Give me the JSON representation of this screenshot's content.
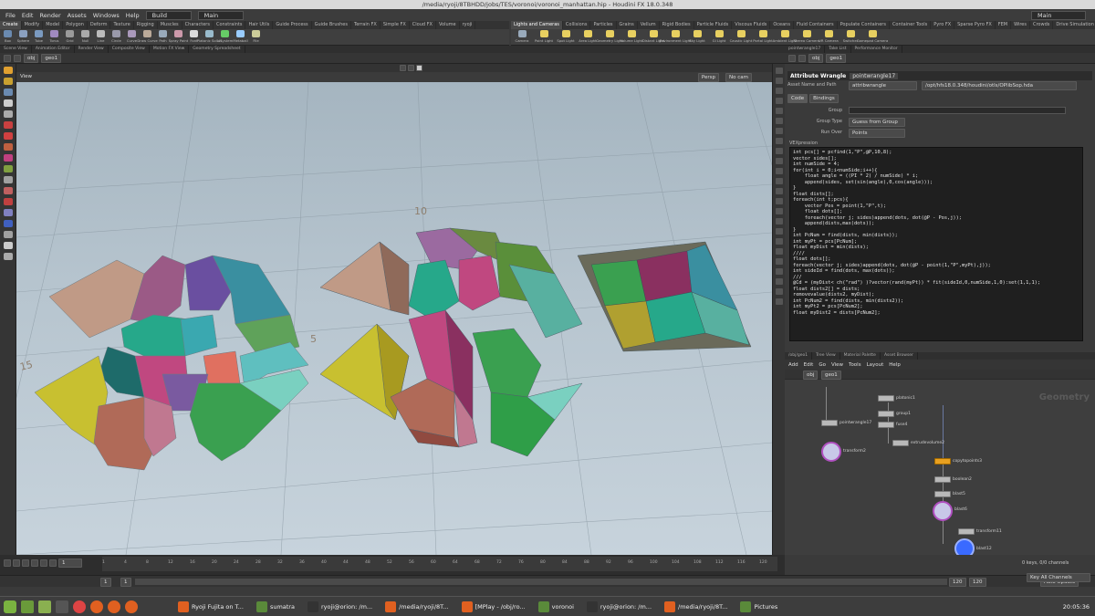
{
  "window_title": "/media/ryoji/8TBHDD/jobs/TES/voronoi/voronoi_manhattan.hip - Houdini FX 18.0.348",
  "menu": [
    "File",
    "Edit",
    "Render",
    "Assets",
    "Windows",
    "Help"
  ],
  "desktop": "Build",
  "session": "Main",
  "main_right": "Main",
  "shelf_tabs_left": [
    "Create",
    "Modify",
    "Model",
    "Polygon",
    "Deform",
    "Texture",
    "Rigging",
    "Muscles",
    "Characters",
    "Constraints",
    "Hair Utils",
    "Guide Process",
    "Guide Brushes",
    "Terrain FX",
    "Simple FX",
    "Cloud FX",
    "Volume",
    "ryoji"
  ],
  "shelf_tabs_right": [
    "Lights and Cameras",
    "Collisions",
    "Particles",
    "Grains",
    "Vellum",
    "Rigid Bodies",
    "Particle Fluids",
    "Viscous Fluids",
    "Oceans",
    "Fluid Containers",
    "Populate Containers",
    "Container Tools",
    "Pyro FX",
    "Sparse Pyro FX",
    "FEM",
    "Wires",
    "Crowds",
    "Drive Simulation"
  ],
  "tools_left": [
    "Box",
    "Sphere",
    "Tube",
    "Torus",
    "Grid",
    "Null",
    "Line",
    "Circle",
    "Curve",
    "Draw Curve",
    "Path",
    "Spray Paint",
    "Font",
    "Platonic Solids",
    "L-System",
    "Metaball",
    "File"
  ],
  "tools_right": [
    "Camera",
    "Point Light",
    "Spot Light",
    "Area Light",
    "Geometry Light",
    "Volume Light",
    "Distant Light",
    "Environment Light",
    "Sky Light",
    "GI Light",
    "Caustic Light",
    "Portal Light",
    "Ambient Light",
    "Stereo Camera",
    "VR Camera",
    "Switcher",
    "Gamepad Camera"
  ],
  "left_pane_tabs": [
    "Scene View",
    "Animation Editor",
    "Render View",
    "Composite View",
    "Motion FX View",
    "Geometry Spreadsheet"
  ],
  "right_top_tabs": [
    "pointwrangle17",
    "Take List",
    "Performance Monitor"
  ],
  "path": {
    "obj": "obj",
    "geo": "geo1"
  },
  "viewport": {
    "label": "View",
    "persp": "Persp",
    "cam": "No cam",
    "grid_labels": [
      "15",
      "5",
      "5",
      "10"
    ]
  },
  "params": {
    "node_type": "Attribute Wrangle",
    "node_name": "pointwrangle17",
    "asset_label": "Asset Name and Path",
    "asset_name": "attribwrangle",
    "asset_path": "/opt/hfs18.0.348/houdini/otls/OPlibSop.hda",
    "tabs": [
      "Code",
      "Bindings"
    ],
    "group_label": "Group",
    "group_type_label": "Group Type",
    "group_type_value": "Guess from Group",
    "run_over_label": "Run Over",
    "run_over_value": "Points",
    "vex_label": "VEXpression"
  },
  "code_lines": [
    "int pcs[] = pcfind(1,\"P\",@P,10,8);",
    "",
    "vector sides[];",
    "int numSide = 4;",
    "for(int i = 0;i<numSide;i++){",
    "    float angle = ((PI * 2) / numSide) * i;",
    "    append(sides, set(sin(angle),0,cos(angle)));",
    "}",
    "float dists[];",
    "foreach(int t;pcs){",
    "    vector Pos = point(1,\"P\",t);",
    "    float dots[];",
    "    foreach(vector j; sides)append(dots, dot(@P - Pos,j));",
    "    append(dists,max(dots));",
    "}",
    "int PcNum = find(dists, min(dists));",
    "int myPt = pcs[PcNum];",
    "float myDist = min(dists);",
    "////",
    "float dots[];",
    "foreach(vector j; sides)append(dots, dot(@P - point(1,\"P\",myPt),j));",
    "int sideId = find(dots, max(dots));",
    "///",
    "@Cd = (myDist< ch(\"rad\") )?vector(rand(myPt)) * fit(sideId,0,numSide,1,0):set(1,1,1);",
    "",
    "float dists2[] = dists;",
    "removevalue(dists2, myDist);",
    "int PcNum2 = find(dists, min(dists2));",
    "int myPt2 = pcs[PcNum2];",
    "float myDist2 = dists[PcNum2];"
  ],
  "net_tabs": [
    "/obj/geo1",
    "Tree View",
    "Material Palette",
    "Asset Browser"
  ],
  "net_menu": [
    "Add",
    "Edit",
    "Go",
    "View",
    "Tools",
    "Layout",
    "Help"
  ],
  "net_watermark": "Geometry",
  "nodes": [
    {
      "name": "platonic1"
    },
    {
      "name": "group1"
    },
    {
      "name": "fuse4"
    },
    {
      "name": "pointwrangle17"
    },
    {
      "name": "transform2"
    },
    {
      "name": "extrudevolume2"
    },
    {
      "name": "copytopoints3"
    },
    {
      "name": "boolean2"
    },
    {
      "name": "blast5"
    },
    {
      "name": "blast6"
    },
    {
      "name": "transform11"
    },
    {
      "name": "blast12"
    }
  ],
  "timeline": {
    "frame": "1",
    "start": "1",
    "start2": "1",
    "end": "120",
    "end2": "120",
    "ticks": [
      "1",
      "4",
      "8",
      "12",
      "16",
      "20",
      "24",
      "28",
      "32",
      "36",
      "40",
      "44",
      "48",
      "52",
      "56",
      "60",
      "64",
      "68",
      "72",
      "76",
      "80",
      "84",
      "88",
      "92",
      "96",
      "100",
      "104",
      "108",
      "112",
      "116",
      "120"
    ]
  },
  "status": {
    "keys": "0 keys, 0/0 channels",
    "channels": "Key All Channels",
    "update": "Auto Update"
  },
  "taskbar": [
    {
      "label": "Ryoji Fujita on T..."
    },
    {
      "label": "sumatra"
    },
    {
      "label": "ryoji@orion: /m..."
    },
    {
      "label": "/media/ryoji/8T..."
    },
    {
      "label": "[MPlay - /obj/ro..."
    },
    {
      "label": "voronoi"
    },
    {
      "label": "ryoji@orion: /m..."
    },
    {
      "label": "/media/ryoji/8T..."
    },
    {
      "label": "Pictures"
    }
  ],
  "clock": "20:05:36"
}
